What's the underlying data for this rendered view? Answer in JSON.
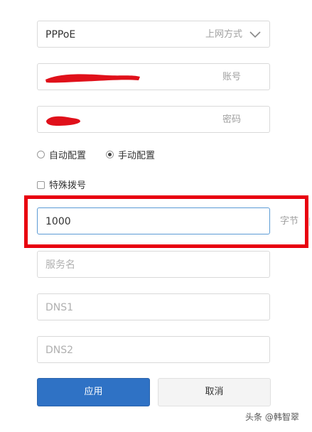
{
  "connection": {
    "selected_type": "PPPoE",
    "type_label": "上网方式"
  },
  "account": {
    "suffix": "账号"
  },
  "password": {
    "suffix": "密码"
  },
  "config_mode": {
    "auto_label": "自动配置",
    "manual_label": "手动配置",
    "selected": "manual"
  },
  "special_dial": {
    "label": "特殊拨号",
    "checked": false
  },
  "mtu": {
    "value": "1000",
    "suffix": "字节"
  },
  "service_name": {
    "placeholder": "服务名"
  },
  "dns1": {
    "placeholder": "DNS1"
  },
  "dns2": {
    "placeholder": "DNS2"
  },
  "buttons": {
    "apply": "应用",
    "cancel": "取消"
  },
  "watermark": {
    "text": "头条 @韩智翠"
  },
  "colors": {
    "primary": "#2f72c5",
    "highlight": "#e8000e",
    "focus_border": "#5b9bd5",
    "redaction": "#e0101a"
  },
  "icons": {
    "type_dropdown": "chevron-down-icon"
  }
}
